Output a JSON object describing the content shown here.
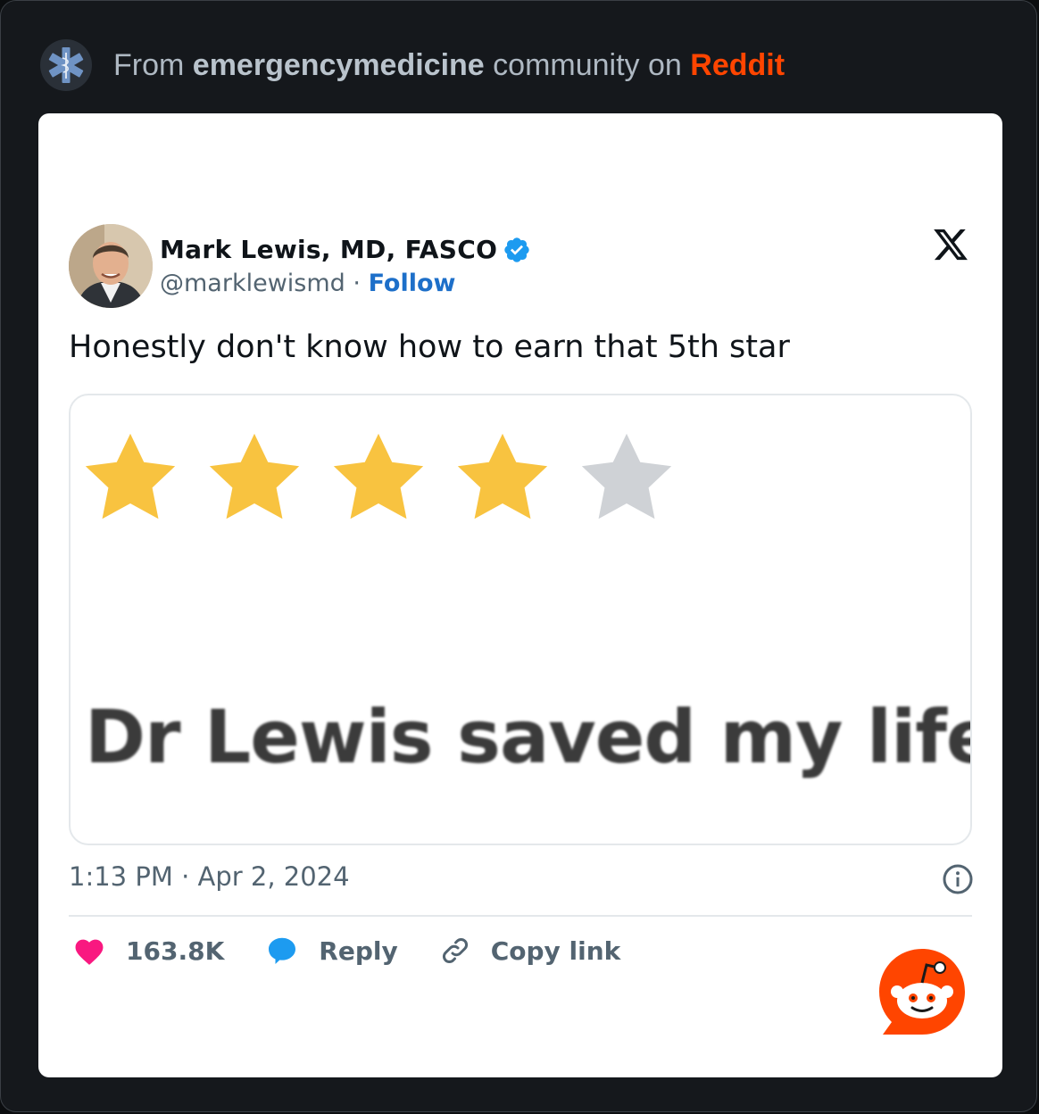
{
  "source": {
    "prefix": "From",
    "community": "emergencymedicine",
    "middle": "community on",
    "platform": "Reddit"
  },
  "tweet": {
    "display_name": "Mark Lewis, MD, FASCO",
    "handle": "@marklewismd",
    "separator": "·",
    "follow_label": "Follow",
    "text": "Honestly don't know how to earn that 5th star",
    "timestamp": "1:13 PM · Apr 2, 2024",
    "rating": {
      "filled_stars": 4,
      "total_stars": 5
    },
    "review_text": "Dr Lewis saved my life!",
    "likes": "163.8K",
    "reply_label": "Reply",
    "copy_link_label": "Copy link"
  },
  "colors": {
    "star_filled": "#f8c340",
    "star_empty": "#cfd2d6",
    "reddit": "#ff4500",
    "verified": "#1d9bf0",
    "like": "#f91880",
    "reply": "#1d9bf0"
  },
  "icons": [
    "star-of-life-icon",
    "verified-badge-icon",
    "x-logo-icon",
    "info-icon",
    "heart-icon",
    "reply-bubble-icon",
    "link-icon",
    "reddit-snoo-icon"
  ]
}
